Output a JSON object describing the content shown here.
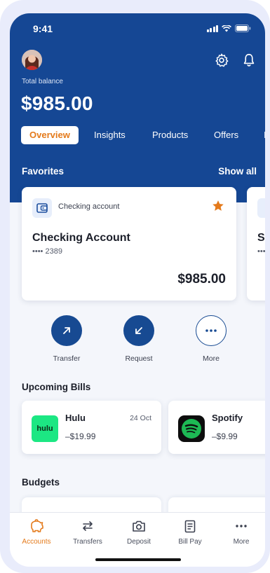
{
  "status_bar": {
    "time": "9:41"
  },
  "header": {
    "balance_label": "Total balance",
    "balance_amount": "$985.00",
    "icons": {
      "settings": "gear-icon",
      "notifications": "bell-icon"
    }
  },
  "tabs": [
    {
      "label": "Overview",
      "active": true
    },
    {
      "label": "Insights"
    },
    {
      "label": "Products"
    },
    {
      "label": "Offers"
    },
    {
      "label": "I"
    }
  ],
  "favorites": {
    "title": "Favorites",
    "show_all": "Show all",
    "account_card": {
      "type_label": "Checking account",
      "name": "Checking Account",
      "number": "•••• 2389",
      "balance": "$985.00",
      "starred": true
    },
    "peek_card": {
      "name": "Sa",
      "number": "••••"
    }
  },
  "actions": [
    {
      "label": "Transfer",
      "icon": "arrow-up-right-icon"
    },
    {
      "label": "Request",
      "icon": "arrow-down-left-icon"
    },
    {
      "label": "More",
      "icon": "more-dots-icon"
    }
  ],
  "upcoming_bills": {
    "title": "Upcoming Bills",
    "items": [
      {
        "name": "Hulu",
        "amount": "–$19.99",
        "date": "24 Oct",
        "logo_text": "hulu",
        "logo_color": "#1ce783"
      },
      {
        "name": "Spotify",
        "amount": "–$9.99",
        "logo_color": "#1db954"
      }
    ]
  },
  "budgets": {
    "title": "Budgets"
  },
  "bottom_nav": [
    {
      "label": "Accounts",
      "icon": "piggy-bank-icon",
      "active": true
    },
    {
      "label": "Transfers",
      "icon": "swap-arrows-icon"
    },
    {
      "label": "Deposit",
      "icon": "camera-icon"
    },
    {
      "label": "Bill Pay",
      "icon": "document-icon"
    },
    {
      "label": "More",
      "icon": "more-dots-icon"
    }
  ],
  "colors": {
    "brand_blue": "#154794",
    "accent_orange": "#e47a1b",
    "background": "#f4f6fb"
  }
}
